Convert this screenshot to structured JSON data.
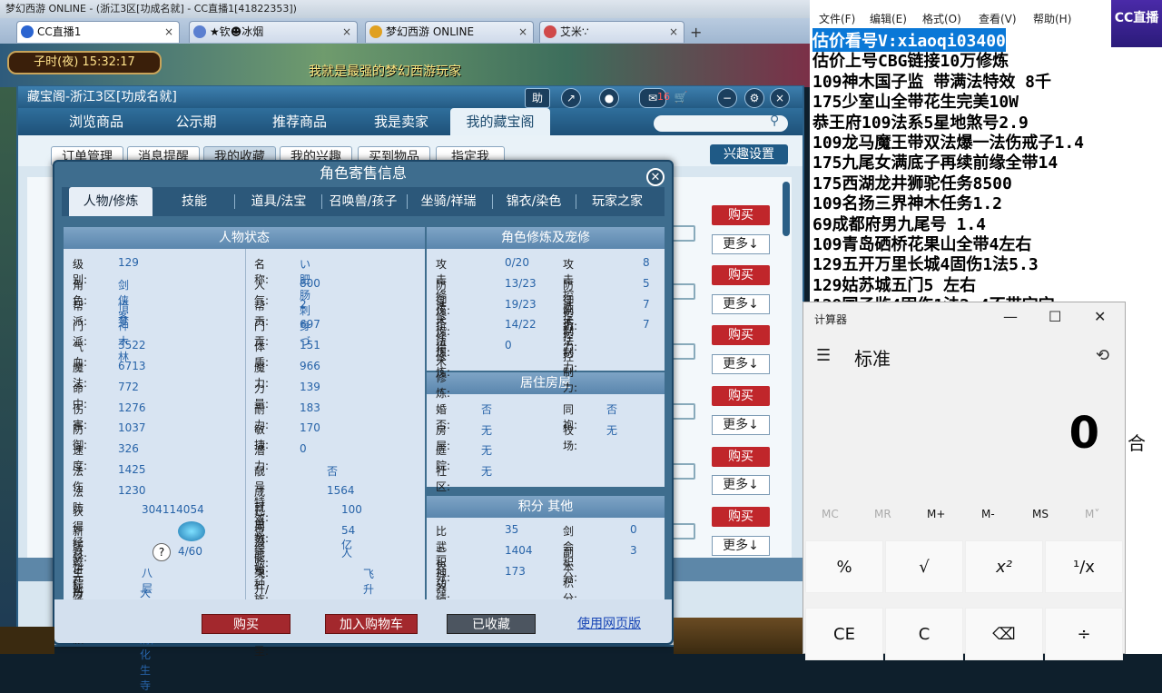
{
  "browser": {
    "window_title": "梦幻西游 ONLINE - (浙江3区[功成名就] - CC直播1[41822353])",
    "tabs": [
      {
        "label": "CC直播1",
        "icon": "cc-icon",
        "active": true
      },
      {
        "label": "★钦☻冰烟",
        "icon": "avatar-icon",
        "active": false
      },
      {
        "label": "梦幻西游 ONLINE",
        "icon": "game-icon",
        "active": false
      },
      {
        "label": "艾米∵",
        "icon": "avatar-icon",
        "active": false
      }
    ],
    "new_tab": "+"
  },
  "game": {
    "clock": "子时(夜) 15:32:17",
    "marquee": "我就是最强的梦幻西游玩家"
  },
  "cbg": {
    "title": "藏宝阁-浙江3区[功成名就]",
    "header_buttons": [
      "助"
    ],
    "badge_count": "16",
    "nav": [
      "浏览商品",
      "公示期",
      "推荐商品",
      "我是卖家",
      "我的藏宝阁"
    ],
    "nav_active": 4,
    "subnav": [
      "订单管理",
      "消息提醒",
      "我的收藏",
      "我的兴趣",
      "买到物品",
      "指定我"
    ],
    "subnav_active": 2,
    "interest_button": "兴趣设置",
    "buy_label": "购买",
    "more_label": "更多↓"
  },
  "dialog": {
    "title": "角色寄售信息",
    "tabs": [
      "人物/修炼",
      "技能",
      "道具/法宝",
      "召唤兽/孩子",
      "坐骑/祥瑞",
      "锦衣/染色",
      "玩家之家"
    ],
    "active_tab": 0,
    "status_header": "人物状态",
    "status_left": [
      {
        "k": "级别:",
        "v": "129"
      },
      {
        "k": "角色:",
        "v": "剑侠客"
      },
      {
        "k": "帮派:",
        "v": "惜梦"
      },
      {
        "k": "门派:",
        "v": "神木林"
      },
      {
        "k": "气血:",
        "v": "3522"
      },
      {
        "k": "魔法:",
        "v": "6713"
      },
      {
        "k": "命中:",
        "v": "772"
      },
      {
        "k": "伤害:",
        "v": "1276"
      },
      {
        "k": "防御:",
        "v": "1037"
      },
      {
        "k": "速度:",
        "v": "326"
      },
      {
        "k": "法伤",
        "v": "1425"
      },
      {
        "k": "法防",
        "v": "1230"
      }
    ],
    "status_right": [
      {
        "k": "名称:",
        "v": "い肥肠刺身づ"
      },
      {
        "k": "人气:",
        "v": "800"
      },
      {
        "k": "帮贡:",
        "v": "2"
      },
      {
        "k": "门贡:",
        "v": "697"
      },
      {
        "k": "体质:",
        "v": "151"
      },
      {
        "k": "魔力:",
        "v": "966"
      },
      {
        "k": "力量:",
        "v": "139"
      },
      {
        "k": "耐力:",
        "v": "183"
      },
      {
        "k": "敏捷:",
        "v": "170"
      },
      {
        "k": "潜力:",
        "v": "0"
      },
      {
        "k": "靓号特效:",
        "v": "否"
      },
      {
        "k": "成就点数:",
        "v": "1564"
      }
    ],
    "extra_left": [
      {
        "k": "获得经验:",
        "v": "304114054"
      },
      {
        "k": "新版乾元丹数量",
        "v": ""
      },
      {
        "k": "月饼粽子机缘:",
        "v": "4/60"
      },
      {
        "k": "生死劫:",
        "v": "八层"
      },
      {
        "k": "历史门派:",
        "v": "大唐官府,化生寺"
      }
    ],
    "extra_right": [
      {
        "k": "已用潜能果:",
        "v": "100"
      },
      {
        "k": "总经验:",
        "v": "54亿"
      },
      {
        "k": "原始种族:",
        "v": "人"
      },
      {
        "k": "飞升/渡劫/化圣:",
        "v": "飞升"
      }
    ],
    "help_icon": "?",
    "cultivation_header": "角色修炼及宠修",
    "cultivation": [
      {
        "k": "攻击修炼:",
        "v": "0/20",
        "k2": "攻击控制力:",
        "v2": "8"
      },
      {
        "k": "防御修炼:",
        "v": "13/23",
        "k2": "防御控制力:",
        "v2": "5"
      },
      {
        "k": "法术修炼:",
        "v": "19/23",
        "k2": "法术控制力:",
        "v2": "7"
      },
      {
        "k": "抗法修炼:",
        "v": "14/22",
        "k2": "抗法控制力:",
        "v2": "7"
      },
      {
        "k": "猎术修炼:",
        "v": "0",
        "k2": "",
        "v2": ""
      }
    ],
    "house_header": "居住房屋",
    "house": [
      {
        "k": "婚否:",
        "v": "否",
        "k2": "同袍:",
        "v2": "否"
      },
      {
        "k": "房屋:",
        "v": "无",
        "k2": "牧场:",
        "v2": "无"
      },
      {
        "k": "庭院:",
        "v": "无",
        "k2": "",
        "v2": ""
      },
      {
        "k": "社区:",
        "v": "无",
        "k2": "",
        "v2": ""
      }
    ],
    "score_header": "积分 其他",
    "scores": [
      {
        "k": "比武积分:",
        "v": "35",
        "k2": "剑会积分:",
        "v2": "0"
      },
      {
        "k": "三界功绩:",
        "v": "1404",
        "k2": "副本积分:",
        "v2": "3"
      },
      {
        "k": "神器积分:",
        "v": "173",
        "k2": "",
        "v2": ""
      }
    ],
    "buttons": {
      "buy": "购买",
      "add_cart": "加入购物车",
      "favorited": "已收藏",
      "web": "使用网页版"
    }
  },
  "notepad": {
    "menu": [
      "文件(F)",
      "编辑(E)",
      "格式(O)",
      "查看(V)",
      "帮助(H)"
    ],
    "lines": [
      "估价看号V:xiaoqi03400",
      "估价上号CBG链接10万修炼",
      "109神木国子监 带满法特效 8千",
      "175少室山全带花生完美10W",
      "恭王府109法系5星地煞号2.9",
      "109龙马魔王带双法爆一法伤戒子1.4",
      "175九尾女满底子再续前缘全带14",
      "175西湖龙井狮驼任务8500",
      "109名扬三界神木任务1.2",
      "69成都府男九尾号  1.4",
      "109青岛硒桥花果山全带4左右",
      "129五开万里长城4固伤1法5.3",
      "129姑苏城五门5 左右",
      "129国子监4固伤1法2.4不带宝宝"
    ],
    "selected_line": 0
  },
  "cc_logo": "CC直播",
  "calculator": {
    "title": "计算器",
    "mode": "标准",
    "display": "0",
    "memory": [
      "MC",
      "MR",
      "M+",
      "M-",
      "MS",
      "M˅"
    ],
    "keys": [
      "%",
      "√",
      "x²",
      "¹/x",
      "CE",
      "C",
      "⌫",
      "÷"
    ],
    "side_text": "合"
  },
  "colors": {
    "buy_red": "#c0262b",
    "selection_blue": "#0a78d7",
    "link_blue": "#1745b5"
  }
}
